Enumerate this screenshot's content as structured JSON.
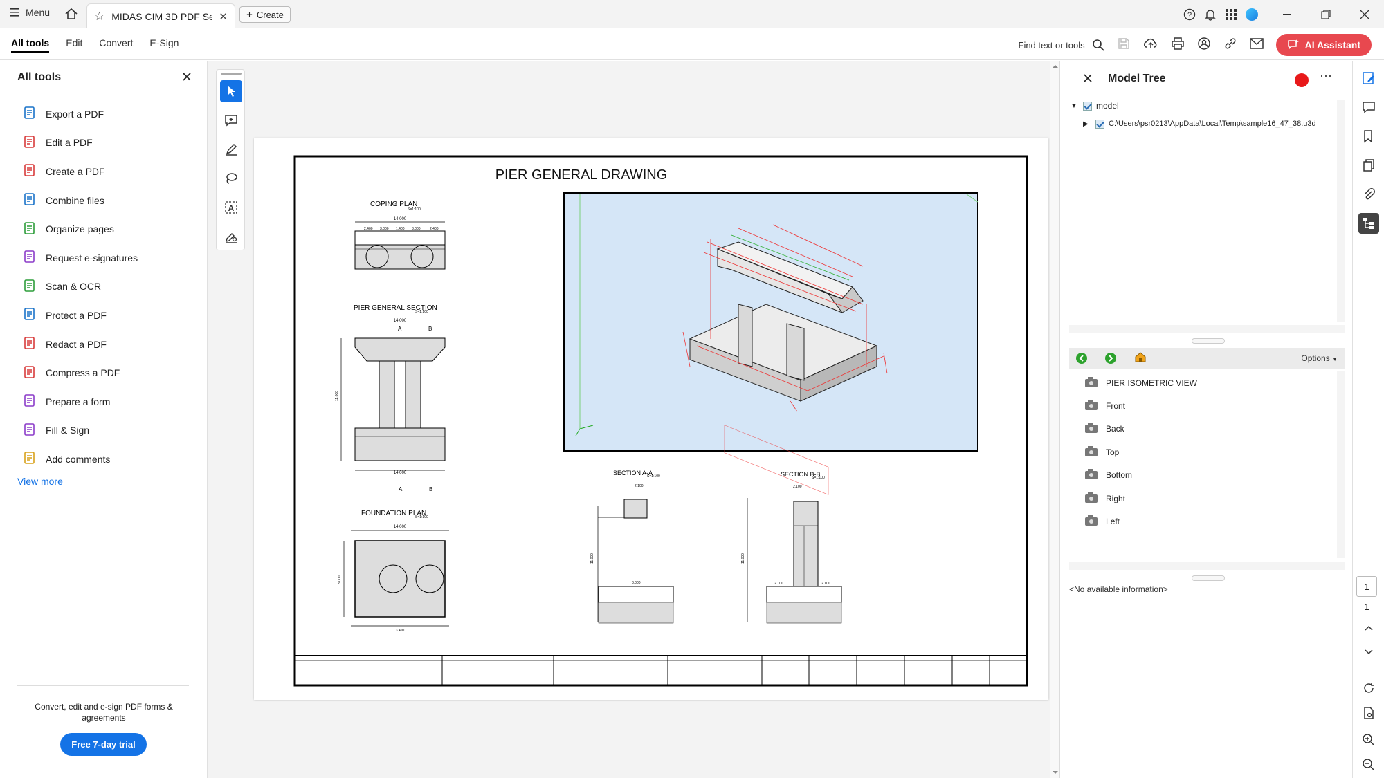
{
  "titlebar": {
    "menu_label": "Menu",
    "tab_title": "MIDAS CIM 3D PDF Sett...",
    "create_label": "Create"
  },
  "toolbar": {
    "nav": [
      "All tools",
      "Edit",
      "Convert",
      "E-Sign"
    ],
    "find_label": "Find text or tools",
    "ai_label": "AI Assistant"
  },
  "leftpanel": {
    "title": "All tools",
    "tools": [
      {
        "label": "Export a PDF",
        "color": "#1a73c9"
      },
      {
        "label": "Edit a PDF",
        "color": "#d83b3b"
      },
      {
        "label": "Create a PDF",
        "color": "#d83b3b"
      },
      {
        "label": "Combine files",
        "color": "#1a73c9"
      },
      {
        "label": "Organize pages",
        "color": "#2d9d3a"
      },
      {
        "label": "Request e-signatures",
        "color": "#8b3bc9"
      },
      {
        "label": "Scan & OCR",
        "color": "#2d9d3a"
      },
      {
        "label": "Protect a PDF",
        "color": "#1a73c9"
      },
      {
        "label": "Redact a PDF",
        "color": "#d83b3b"
      },
      {
        "label": "Compress a PDF",
        "color": "#d83b3b"
      },
      {
        "label": "Prepare a form",
        "color": "#8b3bc9"
      },
      {
        "label": "Fill & Sign",
        "color": "#8b3bc9"
      },
      {
        "label": "Add comments",
        "color": "#d8a21b"
      }
    ],
    "view_more": "View more",
    "promo_text": "Convert, edit and e-sign PDF forms & agreements",
    "trial_label": "Free 7-day trial"
  },
  "drawing": {
    "title": "PIER GENERAL DRAWING",
    "coping_plan": "COPING PLAN",
    "pier_section": "PIER GENERAL SECTION",
    "foundation_plan": "FOUNDATION PLAN",
    "section_aa": "SECTION A-A",
    "section_bb": "SECTION B-B",
    "scale": "S=1:100",
    "mark_a": "A",
    "mark_b": "B",
    "dims": {
      "d14000": "14.000",
      "d2400": "2.400",
      "d3000": "3.000",
      "d1400": "1.400",
      "d3400": "3.400",
      "d2100": "2.100",
      "d8000": "8.000",
      "d11000": "11.000",
      "d1100": "1.100",
      "d1000": "1.000",
      "d100": "100"
    }
  },
  "modeltree": {
    "title": "Model Tree",
    "root": "model",
    "file": "C:\\Users\\psr0213\\AppData\\Local\\Temp\\sample16_47_38.u3d",
    "options_label": "Options",
    "views": [
      "PIER ISOMETRIC VIEW",
      "Front",
      "Back",
      "Top",
      "Bottom",
      "Right",
      "Left"
    ],
    "no_info": "<No available information>"
  },
  "page": {
    "current": "1",
    "total": "1"
  }
}
